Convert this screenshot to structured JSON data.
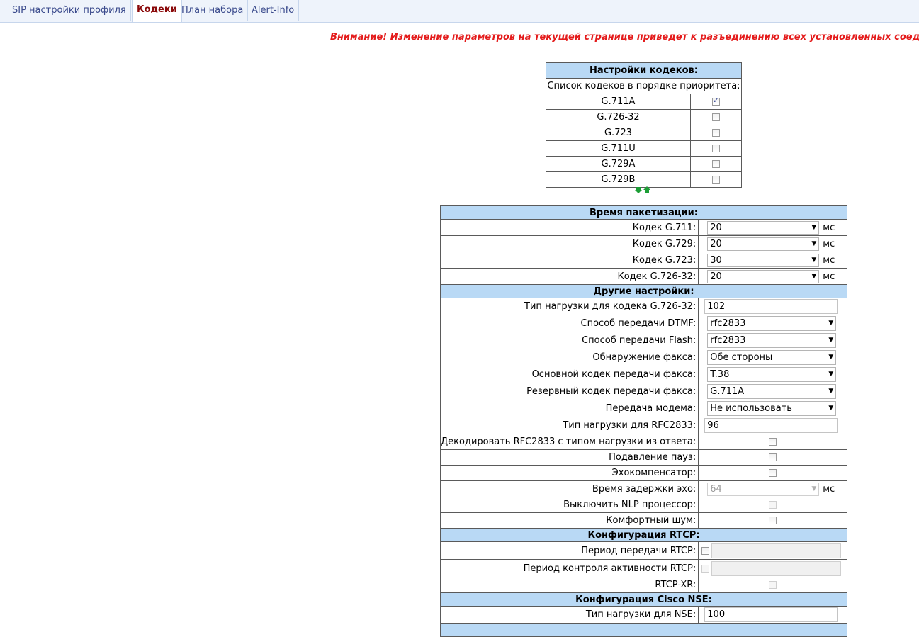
{
  "tabs": [
    {
      "label": "SIP настройки профиля",
      "active": false
    },
    {
      "label": "Кодеки",
      "active": true
    },
    {
      "label": "План набора",
      "active": false
    },
    {
      "label": "Alert-Info",
      "active": false
    }
  ],
  "warning": "Внимание! Изменение параметров на текущей странице приведет к разъединению всех установленных соеди",
  "codecs": {
    "header": "Настройки кодеков:",
    "subheader": "Список кодеков в порядке приоритета:",
    "items": [
      {
        "name": "G.711A",
        "checked": true
      },
      {
        "name": "G.726-32",
        "checked": false
      },
      {
        "name": "G.723",
        "checked": false
      },
      {
        "name": "G.711U",
        "checked": false
      },
      {
        "name": "G.729A",
        "checked": false
      },
      {
        "name": "G.729B",
        "checked": false
      }
    ],
    "reorder_icon": "reorder-arrows-icon"
  },
  "packetization": {
    "header": "Время пакетизации:",
    "rows": [
      {
        "label": "Кодек G.711:",
        "value": "20",
        "unit": "мс"
      },
      {
        "label": "Кодек G.729:",
        "value": "20",
        "unit": "мс"
      },
      {
        "label": "Кодек G.723:",
        "value": "30",
        "unit": "мс"
      },
      {
        "label": "Кодек G.726-32:",
        "value": "20",
        "unit": "мс"
      }
    ]
  },
  "other": {
    "header": "Другие настройки:",
    "g726_payload_label": "Тип нагрузки для кодека G.726-32:",
    "g726_payload_value": "102",
    "dtmf_label": "Способ передачи DTMF:",
    "dtmf_value": "rfc2833",
    "flash_label": "Способ передачи Flash:",
    "flash_value": "rfc2833",
    "fax_detect_label": "Обнаружение факса:",
    "fax_detect_value": "Обе стороны",
    "fax_main_label": "Основной кодек передачи факса:",
    "fax_main_value": "T.38",
    "fax_backup_label": "Резервный кодек передачи факса:",
    "fax_backup_value": "G.711A",
    "modem_label": "Передача модема:",
    "modem_value": "Не использовать",
    "rfc2833_payload_label": "Тип нагрузки для RFC2833:",
    "rfc2833_payload_value": "96",
    "decode_rfc_label": "Декодировать RFC2833 с типом нагрузки из ответа:",
    "decode_rfc_checked": false,
    "vad_label": "Подавление пауз:",
    "vad_checked": false,
    "echo_label": "Эхокомпенсатор:",
    "echo_checked": false,
    "echo_delay_label": "Время задержки эхо:",
    "echo_delay_value": "64",
    "echo_delay_unit": "мс",
    "nlp_label": "Выключить NLP процессор:",
    "nlp_checked": false,
    "comfort_label": "Комфортный шум:",
    "comfort_checked": false
  },
  "rtcp": {
    "header": "Конфигурация RTCP:",
    "period_label": "Период передачи RTCP:",
    "control_label": "Период контроля активности RTCP:",
    "xr_label": "RTCP-XR:"
  },
  "nse": {
    "header": "Конфигурация Cisco NSE:",
    "payload_label": "Тип нагрузки для NSE:",
    "payload_value": "100"
  }
}
